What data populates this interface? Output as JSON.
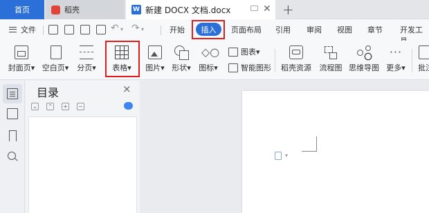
{
  "tabs": {
    "home": "首页",
    "app": "稻壳",
    "document": "新建 DOCX 文档.docx",
    "document_icon_letter": "W"
  },
  "menu": {
    "file_label": "文件",
    "ribbon_tabs": [
      "开始",
      "插入",
      "页面布局",
      "引用",
      "审阅",
      "视图",
      "章节",
      "开发工具"
    ],
    "active_tab": "插入"
  },
  "toolbar": {
    "cover": "封面页",
    "blank": "空白页",
    "page_break": "分页",
    "table": "表格",
    "picture": "图片",
    "shape": "形状",
    "icon": "图标",
    "chart": "图表",
    "smart_art": "智能图形",
    "daoke_resources": "稻壳资源",
    "flowchart": "流程图",
    "mindmap": "思维导图",
    "more": "更多",
    "comment": "批注",
    "dropdown_glyph": "▾",
    "iconset_glyph": "◇○",
    "more_glyph": "···"
  },
  "toc": {
    "title": "目录",
    "close": "×",
    "tools": [
      "⌄",
      "⌃",
      "+",
      "−"
    ]
  },
  "window": {
    "close_glyph": "✕",
    "add_glyph": "+"
  },
  "colors": {
    "accent": "#2b6fd8",
    "highlight_box": "#e11b1b"
  }
}
